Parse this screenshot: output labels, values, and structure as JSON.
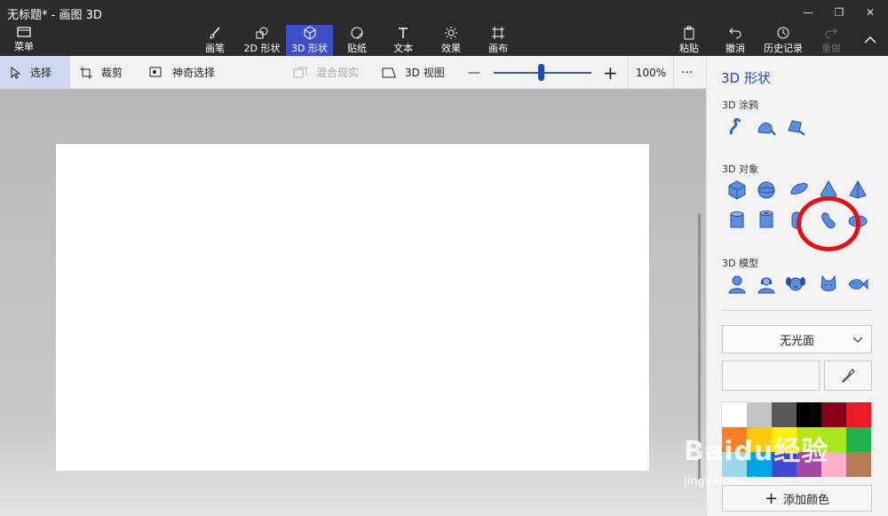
{
  "window": {
    "title": "无标题* - 画图 3D"
  },
  "ribbon": {
    "menu": "菜单",
    "tabs": [
      "画笔",
      "2D 形状",
      "3D 形状",
      "贴纸",
      "文本",
      "效果",
      "画布"
    ],
    "paste": "粘贴",
    "undo": "撤消",
    "history": "历史记录",
    "redo": "重做"
  },
  "toolbar": {
    "select": "选择",
    "crop": "裁剪",
    "magic_select": "神奇选择",
    "mixed_reality": "混合现实",
    "view_3d": "3D 视图",
    "zoom_minus": "—",
    "zoom_plus": "+",
    "zoom_level": "100%",
    "zoom_fraction": 0.48,
    "more": "···"
  },
  "panel": {
    "title": "3D 形状",
    "doodle_label": "3D 涂鸦",
    "objects_label": "3D 对象",
    "models_label": "3D 模型",
    "finish": "无光面",
    "add_color": "添加颜色"
  },
  "colors": {
    "accent": "#3c4fc4",
    "icon_blue": "#5b8fdd",
    "highlight_ring": "#e41010",
    "swatches": [
      "#ffffff",
      "#c3c3c3",
      "#585858",
      "#000000",
      "#880015",
      "#ed1c24",
      "#ff7f27",
      "#ffc90e",
      "#fff200",
      "#b5e61d",
      "#a8e61d",
      "#22b14c",
      "#99d9ea",
      "#00a2e8",
      "#3f48cc",
      "#a349a4",
      "#ffaec9",
      "#b97a57"
    ]
  },
  "watermark": {
    "brand": "Baidu经验",
    "url": "jingyan.baidu.com"
  }
}
